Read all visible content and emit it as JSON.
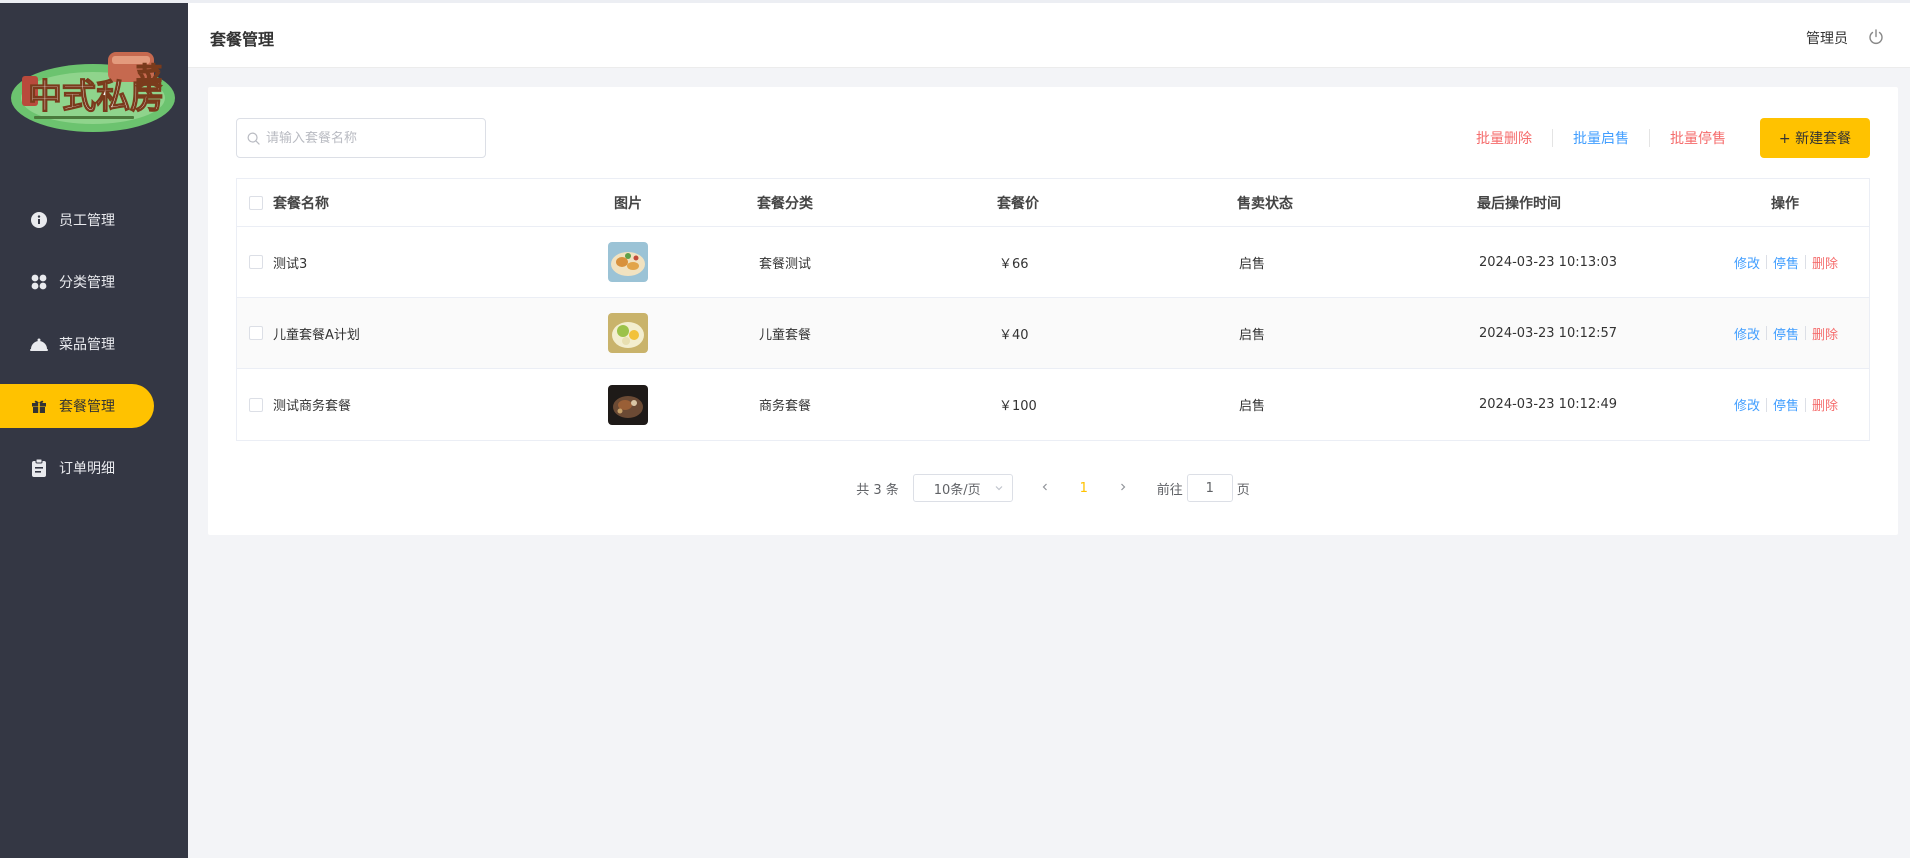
{
  "header": {
    "title": "套餐管理",
    "user": "管理员"
  },
  "sidebar": {
    "logo_text": "中式私房菜",
    "items": [
      {
        "label": "员工管理",
        "icon": "info-icon"
      },
      {
        "label": "分类管理",
        "icon": "grid-icon"
      },
      {
        "label": "菜品管理",
        "icon": "dish-cover-icon"
      },
      {
        "label": "套餐管理",
        "icon": "gift-icon",
        "active": true
      },
      {
        "label": "订单明细",
        "icon": "clipboard-icon"
      }
    ]
  },
  "toolbar": {
    "search_placeholder": "请输入套餐名称",
    "batch_delete": "批量删除",
    "batch_enable": "批量启售",
    "batch_disable": "批量停售",
    "add_button": "+ 新建套餐"
  },
  "table": {
    "columns": [
      "套餐名称",
      "图片",
      "套餐分类",
      "套餐价",
      "售卖状态",
      "最后操作时间",
      "操作"
    ],
    "rows": [
      {
        "name": "测试3",
        "category": "套餐测试",
        "price": "￥66",
        "status": "启售",
        "time": "2024-03-23 10:13:03",
        "edit": "修改",
        "toggle": "停售",
        "delete": "删除"
      },
      {
        "name": "儿童套餐A计划",
        "category": "儿童套餐",
        "price": "￥40",
        "status": "启售",
        "time": "2024-03-23 10:12:57",
        "edit": "修改",
        "toggle": "停售",
        "delete": "删除"
      },
      {
        "name": "测试商务套餐",
        "category": "商务套餐",
        "price": "￥100",
        "status": "启售",
        "time": "2024-03-23 10:12:49",
        "edit": "修改",
        "toggle": "停售",
        "delete": "删除"
      }
    ]
  },
  "pagination": {
    "total": "共 3 条",
    "page_size": "10条/页",
    "current_page": "1",
    "goto_label": "前往",
    "goto_value": "1",
    "page_suffix": "页"
  },
  "colors": {
    "accent": "#ffc200",
    "sidebar_bg": "#343744",
    "link_blue": "#419eff",
    "link_red": "#f56c6c"
  }
}
